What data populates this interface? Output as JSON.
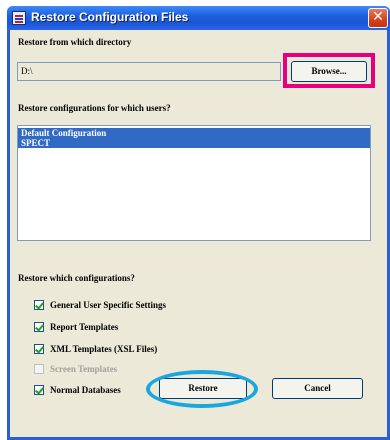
{
  "window": {
    "title": "Restore Configuration Files",
    "close_label": "✕"
  },
  "directory": {
    "label": "Restore from which directory",
    "value": "D:\\",
    "browse_label": "Browse..."
  },
  "users": {
    "label": "Restore configurations for which users?",
    "items": [
      "Default Configuration",
      "SPECT"
    ],
    "selected": [
      "Default Configuration",
      "SPECT"
    ]
  },
  "configs": {
    "label": "Restore which configurations?",
    "options": [
      {
        "label": "General User Specific Settings",
        "checked": true,
        "enabled": true
      },
      {
        "label": "Report Templates",
        "checked": true,
        "enabled": true
      },
      {
        "label": "XML Templates (XSL Files)",
        "checked": true,
        "enabled": true
      },
      {
        "label": "Screen Templates",
        "checked": false,
        "enabled": false
      },
      {
        "label": "Normal Databases",
        "checked": true,
        "enabled": true
      }
    ]
  },
  "actions": {
    "restore_label": "Restore",
    "cancel_label": "Cancel"
  },
  "colors": {
    "highlight_browse": "#e6007e",
    "highlight_restore": "#1aa7e0",
    "selection": "#316ac5",
    "titlebar": "#1f5fe0"
  }
}
